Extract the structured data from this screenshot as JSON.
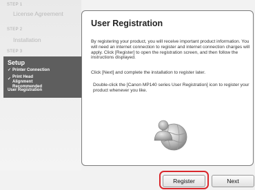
{
  "sidebar": {
    "steps": [
      {
        "step_label": "STEP 1",
        "title": "License Agreement"
      },
      {
        "step_label": "STEP 2",
        "title": "Installation"
      },
      {
        "step_label": "STEP 3"
      }
    ],
    "setup": {
      "title": "Setup",
      "items": [
        {
          "check": "✓",
          "label": "Printer Connection"
        },
        {
          "check": "✓",
          "label": "Print Head Alignment Recommended"
        },
        {
          "check": "",
          "label": "User Registration"
        }
      ]
    }
  },
  "main": {
    "title": "User Registration",
    "paragraphs": [
      "By registering your product, you will receive important product information. You will need an internet connection to register and internet connection charges will apply. Click [Register] to open the registration screen, and then follow the instructions displayed.",
      "Click [Next] and complete the installation to register later.",
      "Double-click the [Canon MP140 series User Registration] icon to register your product whenever you like."
    ],
    "illustration_icon": "user-globe-icon"
  },
  "buttons": {
    "register_label": "Register",
    "next_label": "Next"
  },
  "colors": {
    "highlight": "#d9262b",
    "setup_panel": "#5e5e5e"
  }
}
